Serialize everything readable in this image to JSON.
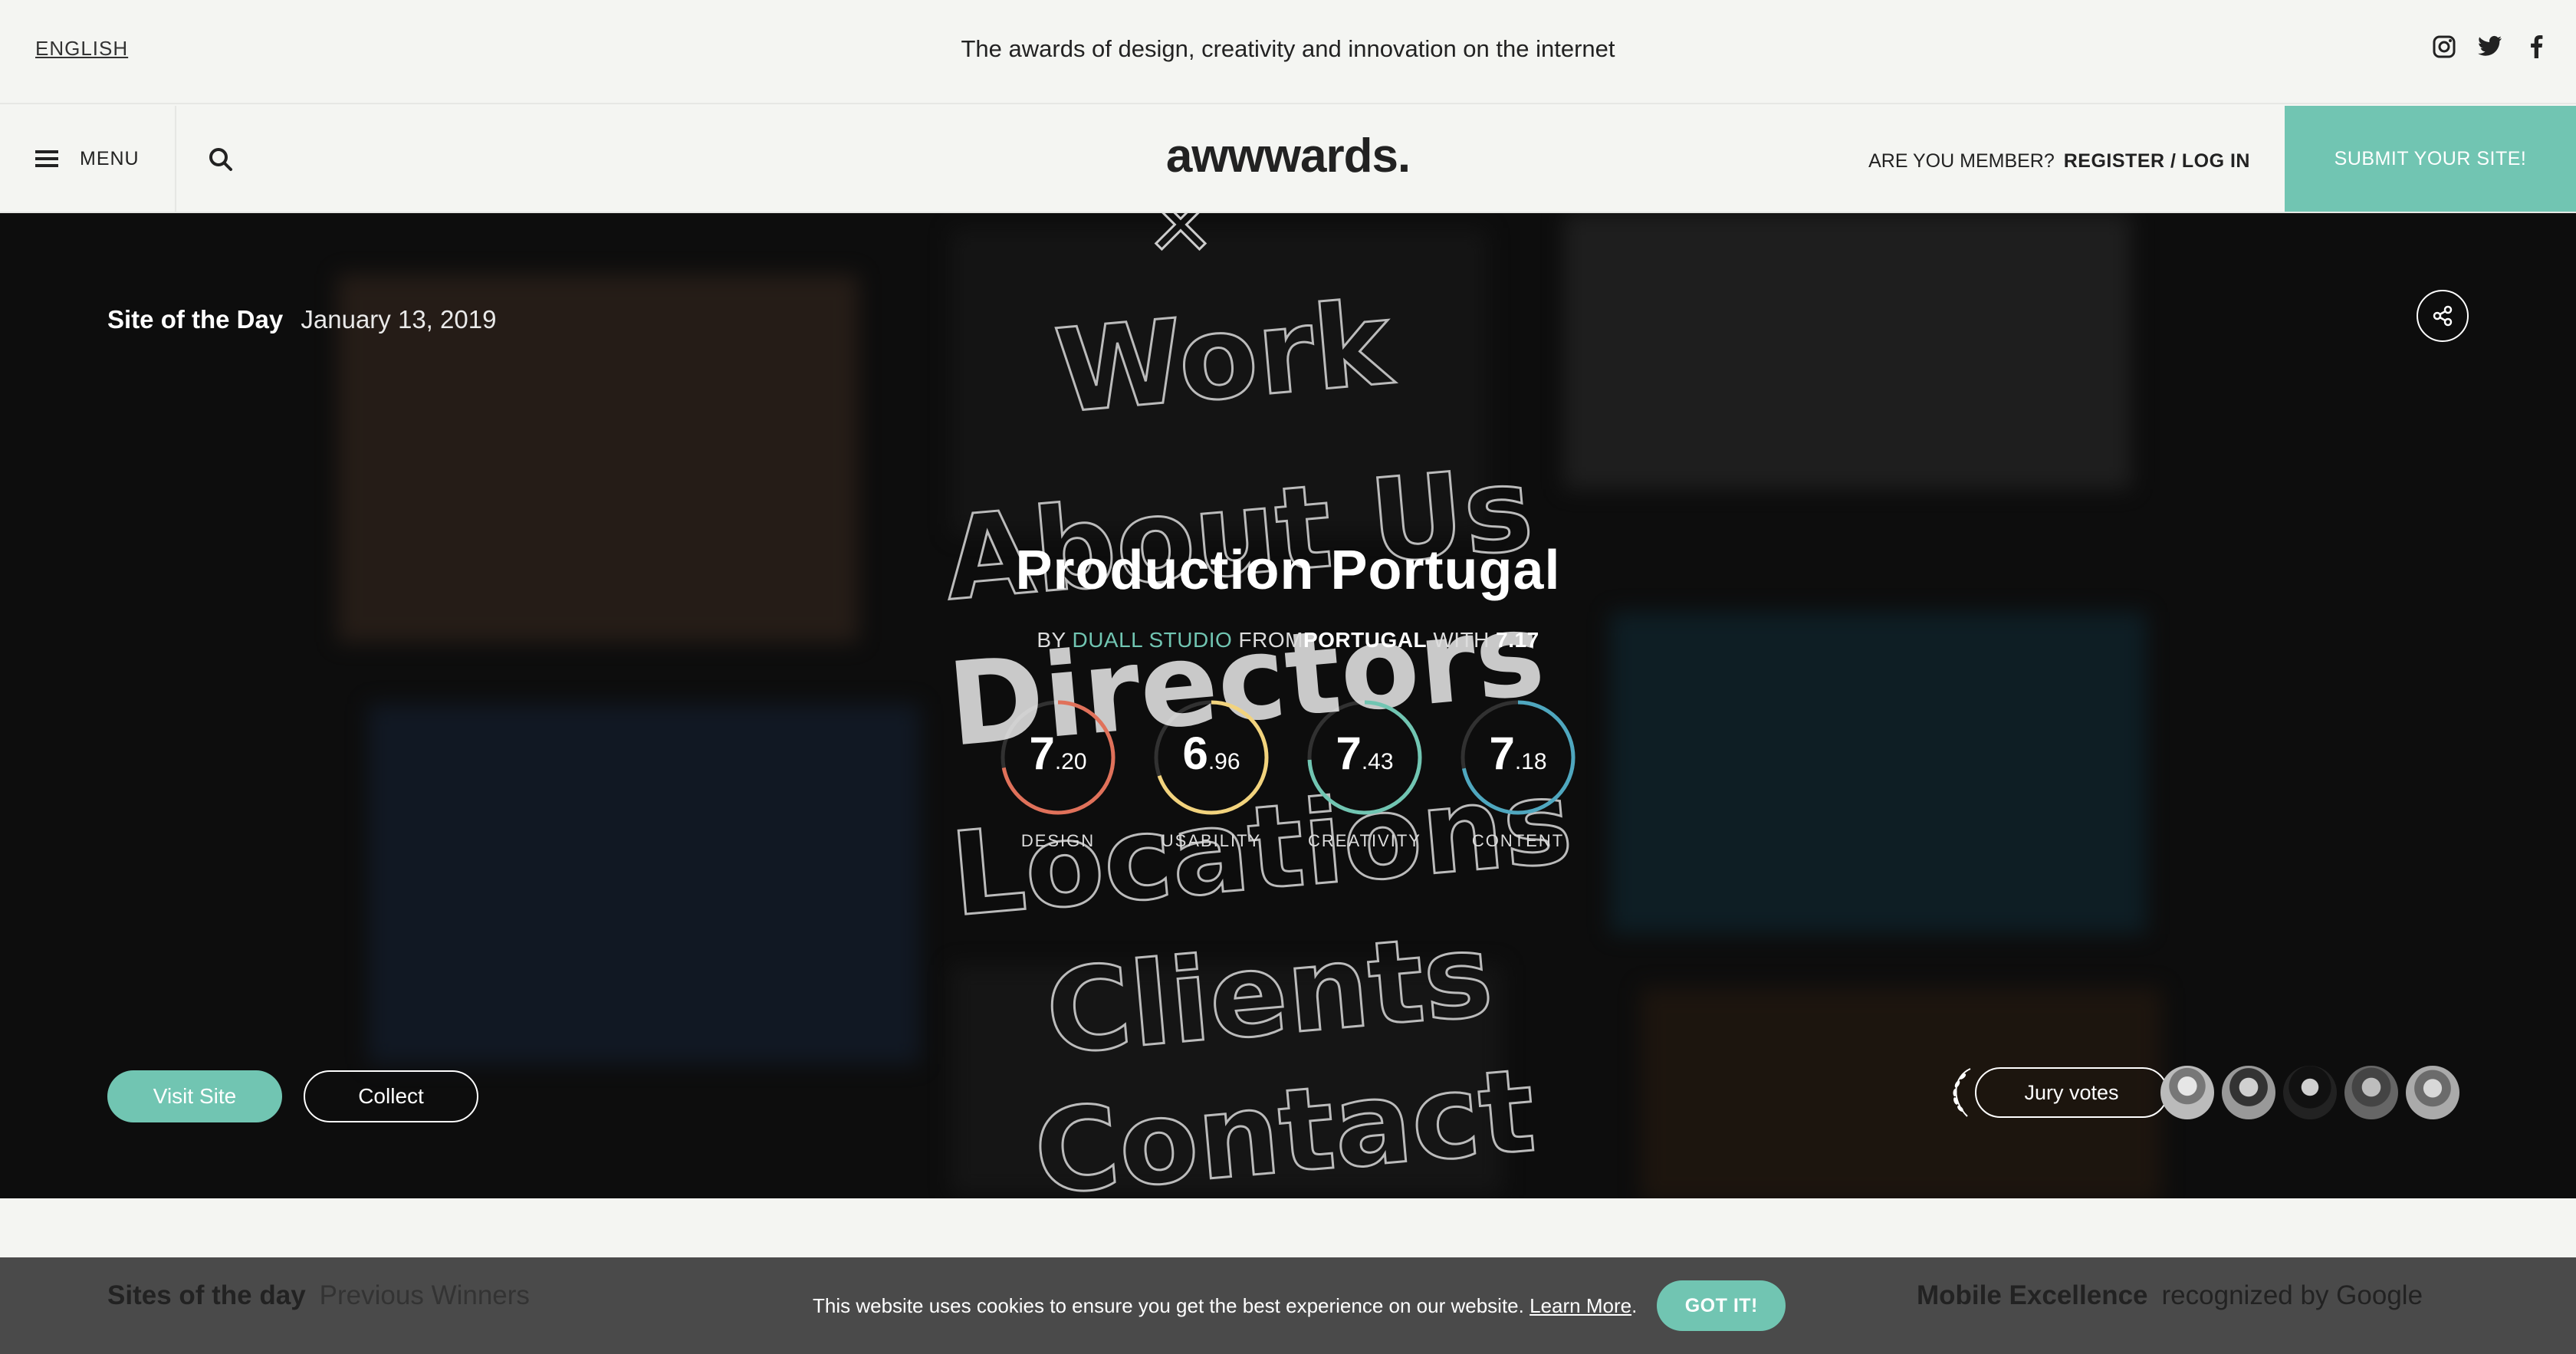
{
  "topbar": {
    "language": "ENGLISH",
    "tagline": "The awards of design, creativity and innovation on the internet",
    "social_icons": [
      "instagram-icon",
      "twitter-icon",
      "facebook-icon"
    ]
  },
  "navbar": {
    "menu_label": "MENU",
    "logo": "awwwards.",
    "member_question": "ARE YOU MEMBER?",
    "register_login": "REGISTER / LOG IN",
    "submit_label": "SUBMIT YOUR SITE!"
  },
  "hero": {
    "badge": "Site of the Day",
    "date": "January 13, 2019",
    "site_title": "Production Portugal",
    "by_prefix": "BY",
    "studio": "DUALL STUDIO",
    "from_label": "FROM",
    "country": "PORTUGAL",
    "with_label": "WITH",
    "overall": "7.17",
    "background_menu": [
      "Work",
      "About Us",
      "Directors",
      "Locations",
      "Clients",
      "Contact"
    ],
    "scores": [
      {
        "label": "DESIGN",
        "int": "7",
        "dec": ".20",
        "value": 7.2,
        "color": "#e0715a"
      },
      {
        "label": "USABILITY",
        "int": "6",
        "dec": ".96",
        "value": 6.96,
        "color": "#f2d37d"
      },
      {
        "label": "CREATIVITY",
        "int": "7",
        "dec": ".43",
        "value": 7.43,
        "color": "#71c5b2"
      },
      {
        "label": "CONTENT",
        "int": "7",
        "dec": ".18",
        "value": 7.18,
        "color": "#4fa7bf"
      }
    ],
    "visit_label": "Visit Site",
    "collect_label": "Collect",
    "jury_label": "Jury votes"
  },
  "sections": {
    "left_title": "Sites of the day",
    "left_sub": "Previous Winners",
    "right_title": "Mobile Excellence",
    "right_sub": "recognized by Google"
  },
  "cookie": {
    "text": "This website uses cookies to ensure you get the best experience on our website.",
    "link": "Learn More",
    "suffix": ".",
    "button": "GOT IT!"
  },
  "colors": {
    "accent": "#71c5b2",
    "hero_bg": "#0d0d0d"
  }
}
